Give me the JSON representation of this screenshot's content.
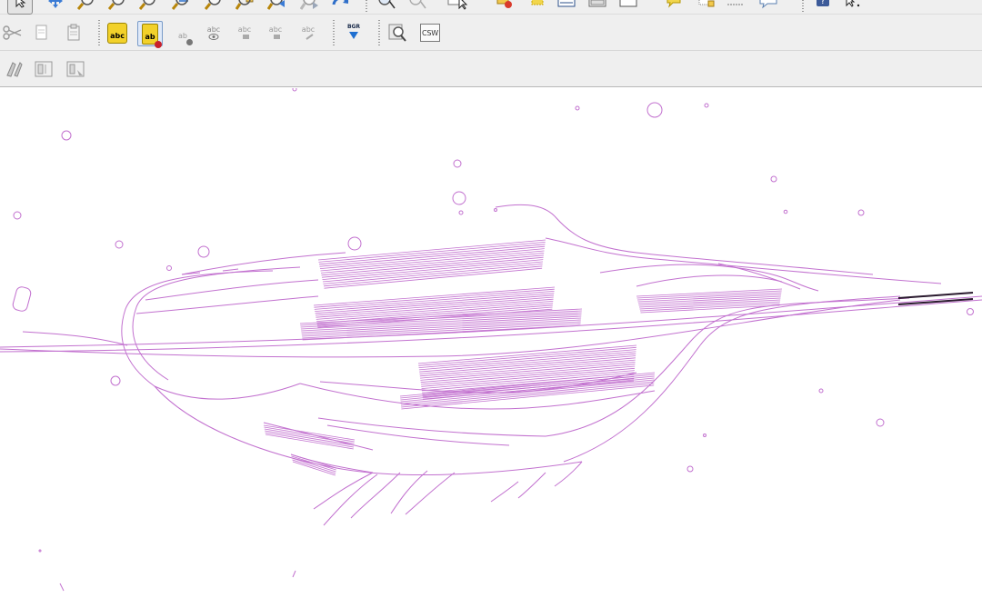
{
  "colors": {
    "toolbar_bg": "#efefef",
    "map_bg": "#ffffff",
    "track": "#c271cf",
    "highlight_track": "#2a1a2e"
  },
  "toolbar_row1": {
    "icons": [
      "select-icon",
      "pan-icon",
      "zoom-in-icon",
      "zoom-out-icon",
      "zoom-full-icon",
      "zoom-layer-icon",
      "zoom-selection-icon",
      "zoom-last-icon",
      "zoom-next-icon",
      "refresh-icon",
      "identify-icon",
      "measure-icon",
      "select-feature-icon",
      "deselect-icon",
      "highlight-icon",
      "attribute-table-icon",
      "field-calculator-icon",
      "statistics-icon",
      "map-tips-icon",
      "bookmark-icon",
      "measure-line-icon",
      "annotation-icon",
      "help-icon",
      "whats-this-icon"
    ]
  },
  "toolbar_row2": {
    "cut_icon": "cut-icon",
    "copy_icon": "copy-icon",
    "paste_icon": "paste-icon",
    "label_abc": "abc",
    "label_ab": "ab",
    "label_small": "ab",
    "label_abc2": "abc",
    "label_abc3": "abc",
    "label_abc4": "abc",
    "label_abc5": "abc",
    "bgr_label": "BGR",
    "csw_label": "CSW"
  },
  "toolbar_row3": {
    "icons": [
      "digitize-icon",
      "georeferencer-icon",
      "georeferencer-settings-icon"
    ]
  }
}
